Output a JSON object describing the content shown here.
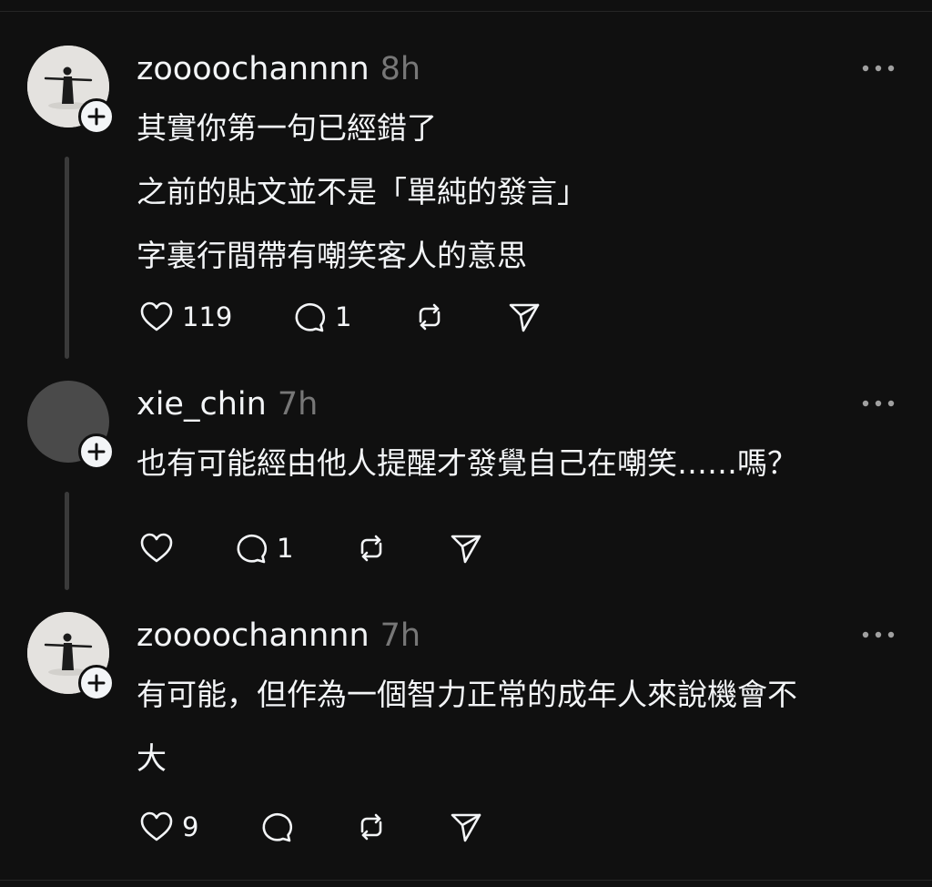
{
  "comments": [
    {
      "username": "zoooochannnn",
      "time": "8h",
      "avatar": "photo-avatar",
      "lines": [
        "其實你第一句已經錯了",
        "之前的貼文並不是「單純的發言」",
        "字裏行間帶有嘲笑客人的意思"
      ],
      "likes": "119",
      "replies": "1"
    },
    {
      "username": "xie_chin",
      "time": "7h",
      "avatar": "blank-avatar",
      "lines": [
        "也有可能經由他人提醒才發覺自己在嘲笑……嗎？"
      ],
      "likes": "",
      "replies": "1"
    },
    {
      "username": "zoooochannnn",
      "time": "7h",
      "avatar": "photo-avatar",
      "lines": [
        "有可能，但作為一個智力正常的成年人來說機會不",
        "大"
      ],
      "likes": "9",
      "replies": ""
    }
  ],
  "icons": {
    "like": "heart-icon",
    "reply": "speech-bubble-icon",
    "repost": "repost-icon",
    "share": "send-icon",
    "more": "more-dots-icon",
    "follow": "plus-icon"
  },
  "colors": {
    "background": "#101010",
    "text": "#f3f5f7",
    "muted": "#777777",
    "thread_line": "#3a3a3a"
  }
}
